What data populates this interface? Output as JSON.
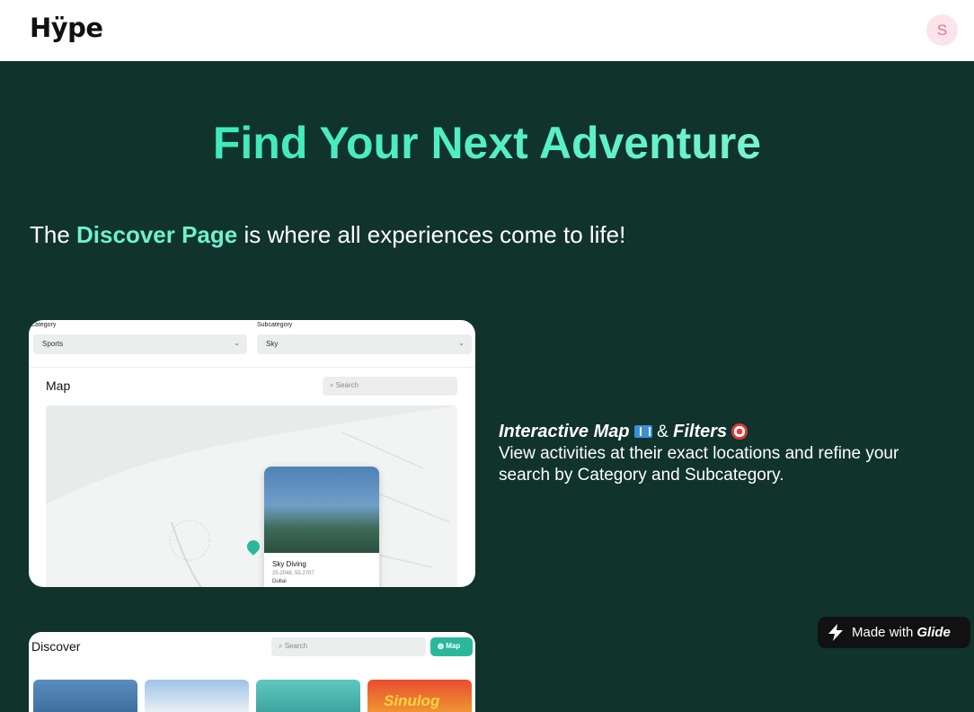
{
  "header": {
    "logo": "Hÿpe",
    "avatar_initial": "S"
  },
  "hero": {
    "title": "Find Your Next Adventure",
    "intro_prefix": "The ",
    "intro_highlight": "Discover Page",
    "intro_suffix": " is where all experiences come to life!"
  },
  "map_card": {
    "category_label": "Category",
    "category_value": "Sports",
    "subcategory_label": "Subcategory",
    "subcategory_value": "Sky",
    "map_title": "Map",
    "search_placeholder": "Search",
    "popup": {
      "name": "Sky Diving",
      "coords": "25.2048, 55.2707",
      "city": "Dubai"
    }
  },
  "feature": {
    "title_part1": "Interactive Map",
    "amp": "&",
    "title_part2": "Filters",
    "description": "View activities at their exact locations and refine your search by Category and Subcategory."
  },
  "discover_card": {
    "title": "Discover",
    "search_placeholder": "Search",
    "map_button": "Map",
    "thumb4_text": "Sinulog"
  },
  "badge": {
    "made_with": "Made with",
    "brand": "Glide"
  },
  "colors": {
    "background": "#10332c",
    "accent": "#2ee6b4",
    "highlight": "#6ff0cc",
    "map_button": "#2bb89a"
  }
}
